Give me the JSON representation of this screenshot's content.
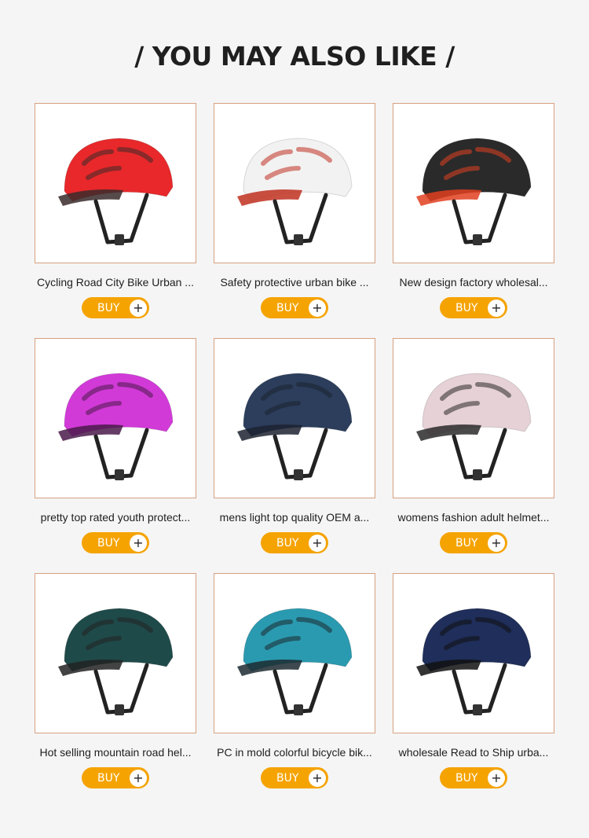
{
  "section": {
    "title": "/ YOU MAY ALSO LIKE /"
  },
  "buy_label": "BUY",
  "plus_glyph": "+",
  "colors": {
    "accent": "#f5a300",
    "border": "#d7a080",
    "background": "#f5f5f5"
  },
  "products": [
    {
      "name": "Cycling Road City Bike Urban ...",
      "icon": "red-visor-helmet-icon",
      "shell": "#e8282a",
      "accent": "#3a2a2a"
    },
    {
      "name": "Safety protective urban bike ...",
      "icon": "white-urban-helmet-icon",
      "shell": "#f2f2f2",
      "accent": "#c03020"
    },
    {
      "name": "New design factory wholesal...",
      "icon": "black-red-mtb-helmet-icon",
      "shell": "#2a2a2a",
      "accent": "#e04020"
    },
    {
      "name": "pretty top rated youth protect...",
      "icon": "pink-road-helmet-icon",
      "shell": "#d23ad8",
      "accent": "#4a1a4a"
    },
    {
      "name": "mens light top quality OEM a...",
      "icon": "navy-matte-helmet-icon",
      "shell": "#2c3e5c",
      "accent": "#1c2230"
    },
    {
      "name": "womens fashion adult helmet...",
      "icon": "pink-visor-helmet-icon",
      "shell": "#e6d1d6",
      "accent": "#2a2a2a"
    },
    {
      "name": "Hot selling mountain road hel...",
      "icon": "green-mtb-helmet-icon",
      "shell": "#1f4a4a",
      "accent": "#222222"
    },
    {
      "name": "PC in mold colorful bicycle bik...",
      "icon": "blue-mtb-helmet-icon",
      "shell": "#2a9ab0",
      "accent": "#1c2a30"
    },
    {
      "name": "wholesale Read to Ship urba...",
      "icon": "navy-cap-helmet-icon",
      "shell": "#1f2e5a",
      "accent": "#111111"
    }
  ]
}
